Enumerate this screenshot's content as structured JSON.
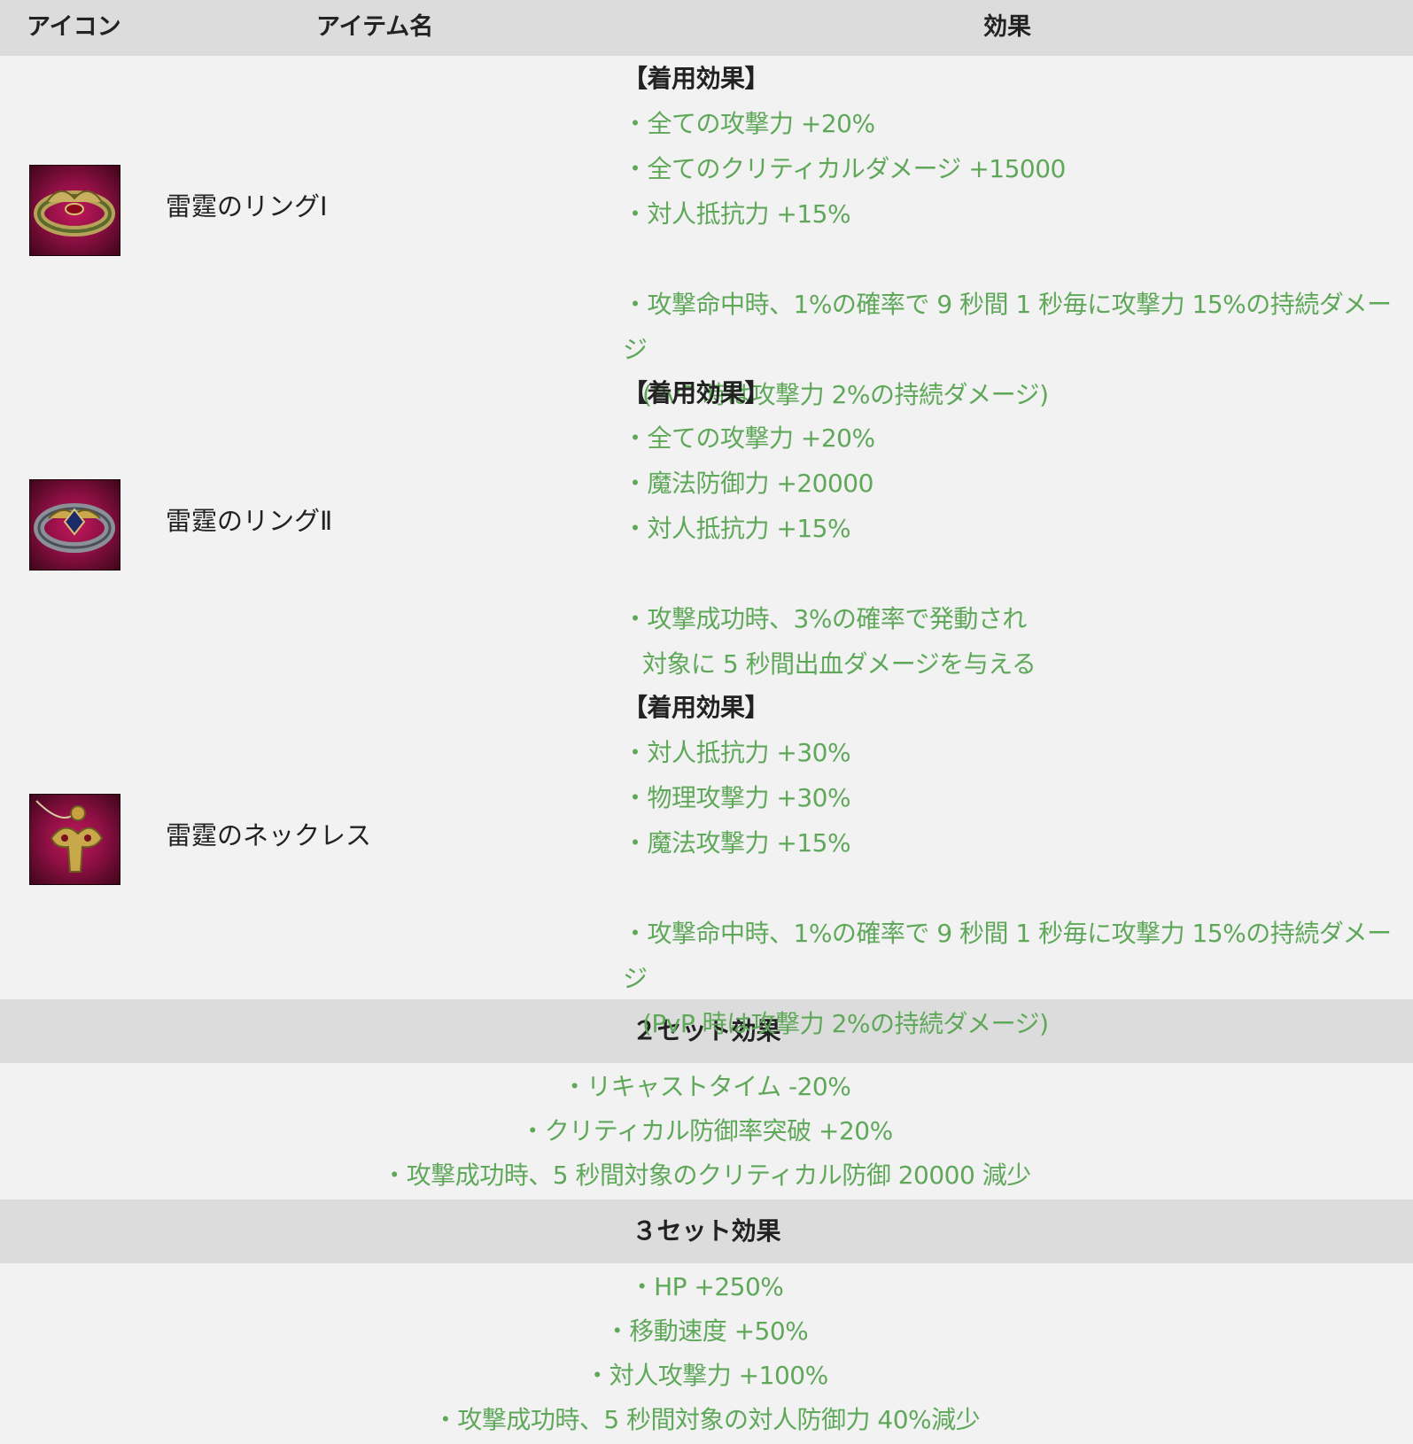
{
  "header": {
    "icon": "アイコン",
    "name": "アイテム名",
    "effect": "効果"
  },
  "items": [
    {
      "icon": "ring-red-gem-icon",
      "name": "雷霆のリングⅠ",
      "effects": [
        {
          "type": "head",
          "text": "【着用効果】"
        },
        {
          "type": "line",
          "text": "・全ての攻撃力 +20%"
        },
        {
          "type": "line",
          "text": "・全てのクリティカルダメージ +15000"
        },
        {
          "type": "line",
          "text": "・対人抵抗力 +15%"
        },
        {
          "type": "blank",
          "text": ""
        },
        {
          "type": "line",
          "text": "・攻撃命中時、1%の確率で 9 秒間 1 秒毎に攻撃力 15%の持続ダメージ"
        },
        {
          "type": "cont",
          "text": "(PvP 時は攻撃力 2%の持続ダメージ)"
        }
      ]
    },
    {
      "icon": "ring-blue-gem-icon",
      "name": "雷霆のリングⅡ",
      "effects": [
        {
          "type": "head",
          "text": "【着用効果】"
        },
        {
          "type": "line",
          "text": "・全ての攻撃力 +20%"
        },
        {
          "type": "line",
          "text": "・魔法防御力 +20000"
        },
        {
          "type": "line",
          "text": "・対人抵抗力 +15%"
        },
        {
          "type": "blank",
          "text": ""
        },
        {
          "type": "line",
          "text": "・攻撃成功時、3%の確率で発動され"
        },
        {
          "type": "cont",
          "text": "対象に 5 秒間出血ダメージを与える"
        }
      ]
    },
    {
      "icon": "necklace-gold-icon",
      "name": "雷霆のネックレス",
      "effects": [
        {
          "type": "head",
          "text": "【着用効果】"
        },
        {
          "type": "line",
          "text": "・対人抵抗力 +30%"
        },
        {
          "type": "line",
          "text": "・物理攻撃力 +30%"
        },
        {
          "type": "line",
          "text": "・魔法攻撃力 +15%"
        },
        {
          "type": "blank",
          "text": ""
        },
        {
          "type": "line",
          "text": "・攻撃命中時、1%の確率で 9 秒間 1 秒毎に攻撃力 15%の持続ダメージ"
        },
        {
          "type": "cont",
          "text": "(PvP 時は攻撃力 2%の持続ダメージ)"
        }
      ]
    }
  ],
  "set2": {
    "title": "２セット効果",
    "lines": [
      "・リキャストタイム -20%",
      "・クリティカル防御率突破 +20%",
      "・攻撃成功時、5 秒間対象のクリティカル防御 20000 減少"
    ]
  },
  "set3": {
    "title": "３セット効果",
    "lines": [
      "・HP +250%",
      "・移動速度 +50%",
      "・対人攻撃力 +100%",
      "・攻撃成功時、5 秒間対象の対人防御力 40%減少"
    ]
  },
  "colors": {
    "effect_text": "#5fa85a",
    "header_bg": "#dcdcdc",
    "body_bg": "#f2f2f2"
  }
}
